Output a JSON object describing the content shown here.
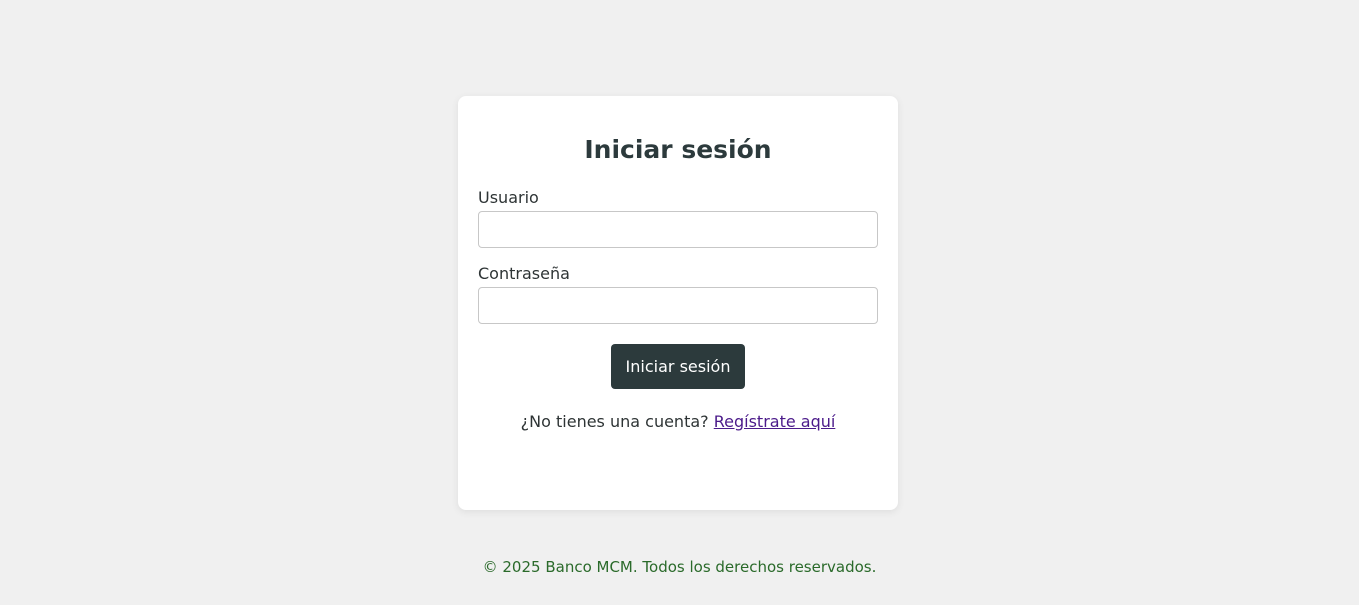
{
  "login": {
    "title": "Iniciar sesión",
    "username_label": "Usuario",
    "username_value": "",
    "password_label": "Contraseña",
    "password_value": "",
    "submit_label": "Iniciar sesión",
    "register_prompt": "¿No tienes una cuenta?",
    "register_link": "Regístrate aquí"
  },
  "footer": {
    "text": "© 2025 Banco MCM. Todos los derechos reservados."
  },
  "colors": {
    "background": "#f0f0f0",
    "card": "#ffffff",
    "primary_button": "#2c3a3c",
    "link": "#4b1a8a",
    "footer_text": "#2a6a2a"
  }
}
